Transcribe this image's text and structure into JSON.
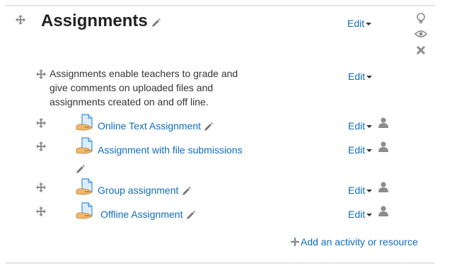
{
  "section": {
    "title": "Assignments",
    "summary": "Assignments enable teachers to grade and give comments on uploaded files and assignments created on and off line.",
    "edit_label": "Edit",
    "icons": [
      "move-icon",
      "pencil-icon",
      "lightbulb-icon",
      "eye-icon",
      "close-icon",
      "assignment-icon",
      "person-icon",
      "plus-icon",
      "caret-down-icon"
    ]
  },
  "activities": [
    {
      "name": "Online Text Assignment",
      "edit_label": "Edit"
    },
    {
      "name": "Assignment with file submissions",
      "edit_label": "Edit"
    },
    {
      "name": "Group assignment",
      "edit_label": "Edit"
    },
    {
      "name": "Offline Assignment",
      "edit_label": "Edit"
    }
  ],
  "footer": {
    "add_label": "Add an activity or resource"
  },
  "colors": {
    "link": "#0f6cbf",
    "icon": "#8c8c8c",
    "divider": "#e3e3e3"
  }
}
